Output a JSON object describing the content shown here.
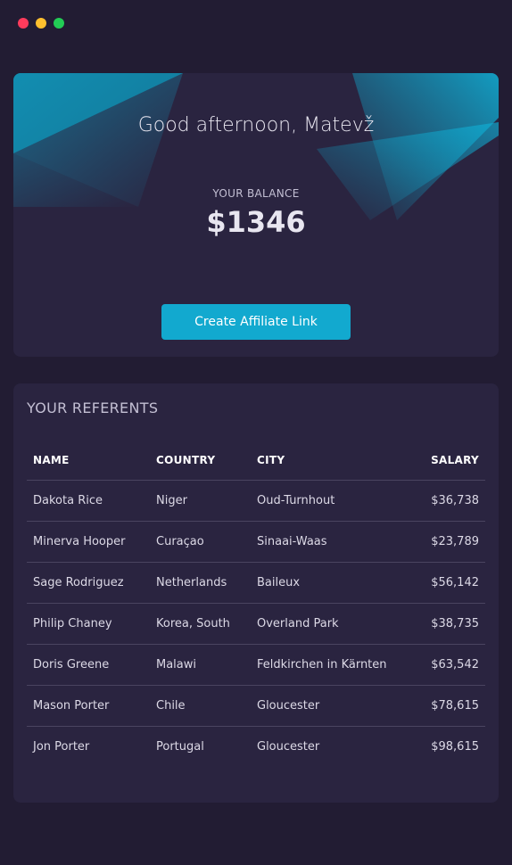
{
  "greeting": "Good afternoon, Matevž",
  "balance": {
    "label": "YOUR BALANCE",
    "value": "$1346"
  },
  "affiliate_button": "Create Affiliate Link",
  "referents": {
    "title": "YOUR REFERENTS",
    "headers": [
      "NAME",
      "COUNTRY",
      "CITY",
      "SALARY"
    ],
    "rows": [
      [
        "Dakota Rice",
        "Niger",
        "Oud-Turnhout",
        "$36,738"
      ],
      [
        "Minerva Hooper",
        "Curaçao",
        "Sinaai-Waas",
        "$23,789"
      ],
      [
        "Sage Rodriguez",
        "Netherlands",
        "Baileux",
        "$56,142"
      ],
      [
        "Philip Chaney",
        "Korea, South",
        "Overland Park",
        "$38,735"
      ],
      [
        "Doris Greene",
        "Malawi",
        "Feldkirchen in Kärnten",
        "$63,542"
      ],
      [
        "Mason Porter",
        "Chile",
        "Gloucester",
        "$78,615"
      ],
      [
        "Jon Porter",
        "Portugal",
        "Gloucester",
        "$98,615"
      ]
    ]
  },
  "colors": {
    "accent": "#12a9cf",
    "background": "#221c33",
    "card": "#2a2440"
  }
}
